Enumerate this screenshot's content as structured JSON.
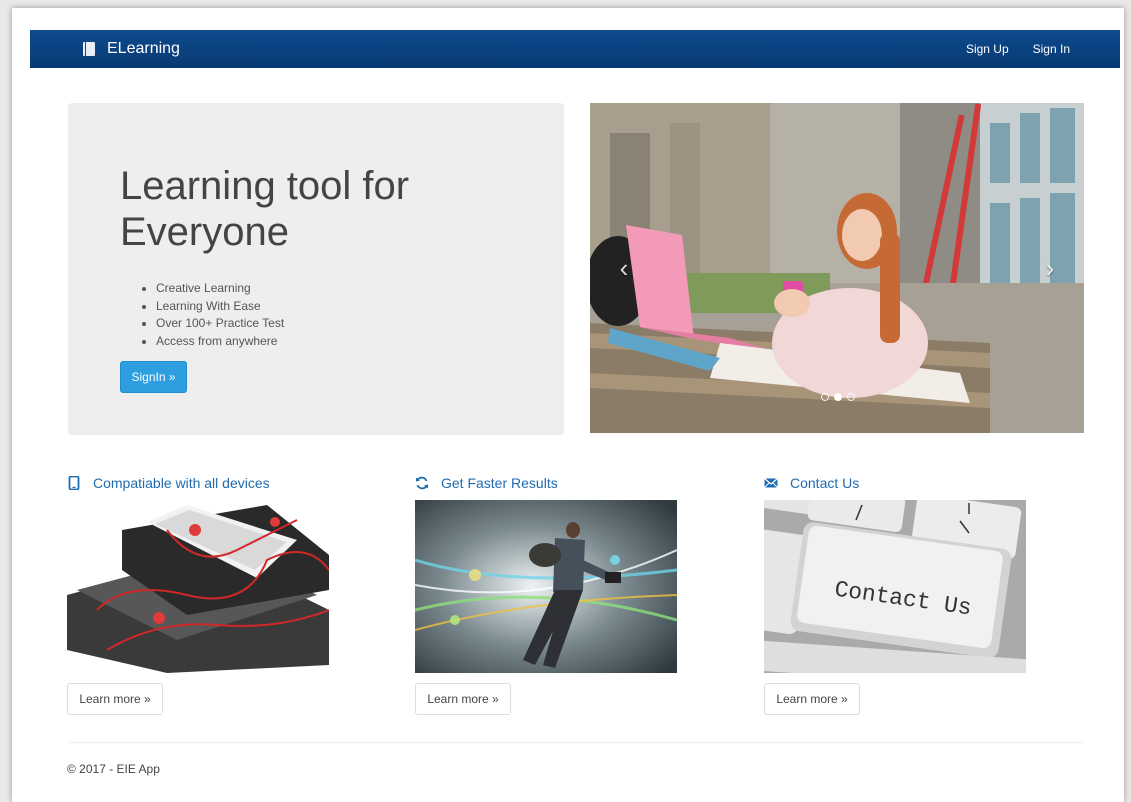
{
  "navbar": {
    "brand": "ELearning",
    "links": [
      "Sign Up",
      "Sign In"
    ]
  },
  "hero": {
    "title": "Learning tool for Everyone",
    "features": [
      "Creative Learning",
      "Learning With Ease",
      "Over 100+ Practice Test",
      "Access from anywhere"
    ],
    "signin_label": "SignIn »"
  },
  "carousel": {
    "prev_icon": "‹",
    "next_icon": "›",
    "slide_count": 3,
    "active_slide": 2
  },
  "features": [
    {
      "title": "Compatiable with all devices",
      "icon": "mobile-phone-icon",
      "button": "Learn more »"
    },
    {
      "title": "Get Faster Results",
      "icon": "refresh-icon",
      "button": "Learn more »"
    },
    {
      "title": "Contact Us",
      "icon": "envelope-icon",
      "button": "Learn more »",
      "image_text": "Contact Us"
    }
  ],
  "footer": {
    "text": "© 2017 - EIE App"
  },
  "colors": {
    "navbar": "#0d4a8d",
    "primary_button": "#2d9ee0",
    "link": "#1f6bb0"
  }
}
